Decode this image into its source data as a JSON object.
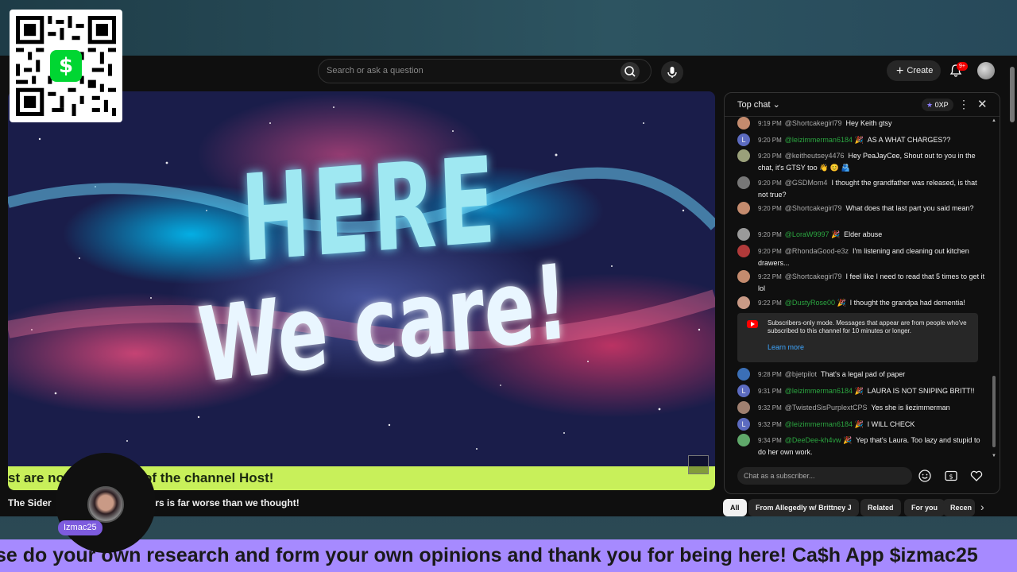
{
  "masthead": {
    "search_placeholder": "Search or ask a question",
    "create_label": "Create",
    "notifications_badge": "9+"
  },
  "video": {
    "headline_top": "HERE",
    "headline_bottom": "We care!",
    "ticker": "st are no          y the views of the channel Host!",
    "title_left": "The Sider",
    "title_right": "ors is far worse than we thought!"
  },
  "host": {
    "name": "Izmac25"
  },
  "chat": {
    "mode_label": "Top chat",
    "xp_label": "0XP",
    "messages": [
      {
        "time": "9:19 PM",
        "user": "@Shortcakegirl79",
        "text": "Hey Keith gtsy",
        "member": false,
        "avatar_color": "#c48b6e"
      },
      {
        "time": "9:20 PM",
        "user": "@leizimmerman6184",
        "text": "AS A WHAT CHARGES??",
        "member": true,
        "avatar_color": "#5c6bc0",
        "avatar_letter": "L"
      },
      {
        "time": "9:20 PM",
        "user": "@keitheutsey4476",
        "text": "Hey PeaJayCee, Shout out to you in the chat, it's GTSY too 👋 😊 🫂",
        "member": false,
        "avatar_color": "#9aa07a"
      },
      {
        "time": "9:20 PM",
        "user": "@GSDMom4",
        "text": "I thought the grandfather was released, is that not true?",
        "member": false,
        "avatar_color": "#777"
      },
      {
        "time": "9:20 PM",
        "user": "@Shortcakegirl79",
        "text": "What does that last part you said mean?",
        "member": false,
        "avatar_color": "#c48b6e"
      },
      {
        "time": "9:20 PM",
        "user": "@LoraW9997",
        "text": "Elder abuse",
        "member": true,
        "avatar_color": "#9a9a9a"
      },
      {
        "time": "9:20 PM",
        "user": "@RhondaGood-e3z",
        "text": "I'm listening and cleaning out kitchen drawers...",
        "member": false,
        "avatar_color": "#b03a3a"
      },
      {
        "time": "9:22 PM",
        "user": "@Shortcakegirl79",
        "text": "I feel like I need to read that 5 times to get it lol",
        "member": false,
        "avatar_color": "#c48b6e"
      },
      {
        "time": "9:22 PM",
        "user": "@DustyRose00",
        "text": "I thought the grandpa had dementia!",
        "member": true,
        "avatar_color": "#c99a86"
      },
      {
        "time": "9:28 PM",
        "user": "@bjetpilot",
        "text": "That's a legal pad of paper",
        "member": false,
        "avatar_color": "#3b6fb6"
      },
      {
        "time": "9:31 PM",
        "user": "@leizimmerman6184",
        "text": "LAURA IS NOT SNIPING BRITT!!",
        "member": true,
        "avatar_color": "#5c6bc0",
        "avatar_letter": "L"
      },
      {
        "time": "9:32 PM",
        "user": "@TwistedSisPurplextCPS",
        "text": "Yes she is liezimmerman",
        "member": false,
        "avatar_color": "#a08070"
      },
      {
        "time": "9:32 PM",
        "user": "@leizimmerman6184",
        "text": "I WILL CHECK",
        "member": true,
        "avatar_color": "#5c6bc0",
        "avatar_letter": "L"
      },
      {
        "time": "9:34 PM",
        "user": "@DeeDee-kh4vw",
        "text": "Yep that's Laura. Too lazy and stupid to do her own work.",
        "member": true,
        "avatar_color": "#5fa86a"
      }
    ],
    "notice_text": "Subscribers-only mode. Messages that appear are from people who've subscribed to this channel for 10 minutes or longer.",
    "notice_link": "Learn more",
    "input_placeholder": "Chat as a subscriber..."
  },
  "chips": [
    "All",
    "From Allegedly w/ Brittney J",
    "Related",
    "For you",
    "Recen"
  ],
  "crawl": {
    "text": "se do your own research and form your own opinions and thank you for being here! Ca$h App $izmac25"
  },
  "colors": {
    "ticker_bg": "#c8f05a",
    "crawl_bg": "#a68aff",
    "member_name": "#2ba640",
    "link": "#3ea6ff",
    "cash_app": "#00d632"
  }
}
